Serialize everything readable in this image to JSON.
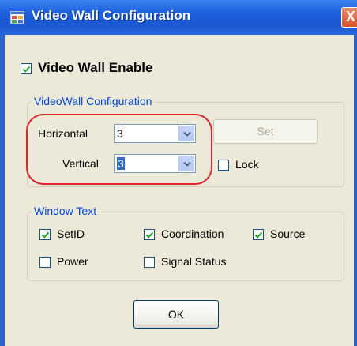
{
  "window": {
    "title": "Video Wall Configuration",
    "close_glyph": "X"
  },
  "enable": {
    "label": "Video Wall Enable",
    "checked": true
  },
  "videowall_group": {
    "title": "VideoWall Configuration",
    "horizontal_label": "Horizontal",
    "horizontal_value": "3",
    "vertical_label": "Vertical",
    "vertical_value": "3",
    "set_label": "Set",
    "lock_label": "Lock",
    "lock_checked": false
  },
  "window_text_group": {
    "title": "Window Text",
    "setid_label": "SetID",
    "setid_checked": true,
    "coordination_label": "Coordination",
    "coordination_checked": true,
    "source_label": "Source",
    "source_checked": true,
    "power_label": "Power",
    "power_checked": false,
    "signal_status_label": "Signal Status",
    "signal_status_checked": false
  },
  "footer": {
    "ok_label": "OK"
  },
  "icons": {
    "app": "app-window-icon",
    "close": "close-icon",
    "dropdown": "chevron-down-icon",
    "check": "checkmark-icon"
  },
  "colors": {
    "titlebar": "#1c5fde",
    "group_title": "#0046d5",
    "highlight": "#e0232a",
    "client_bg": "#ece9d8"
  }
}
